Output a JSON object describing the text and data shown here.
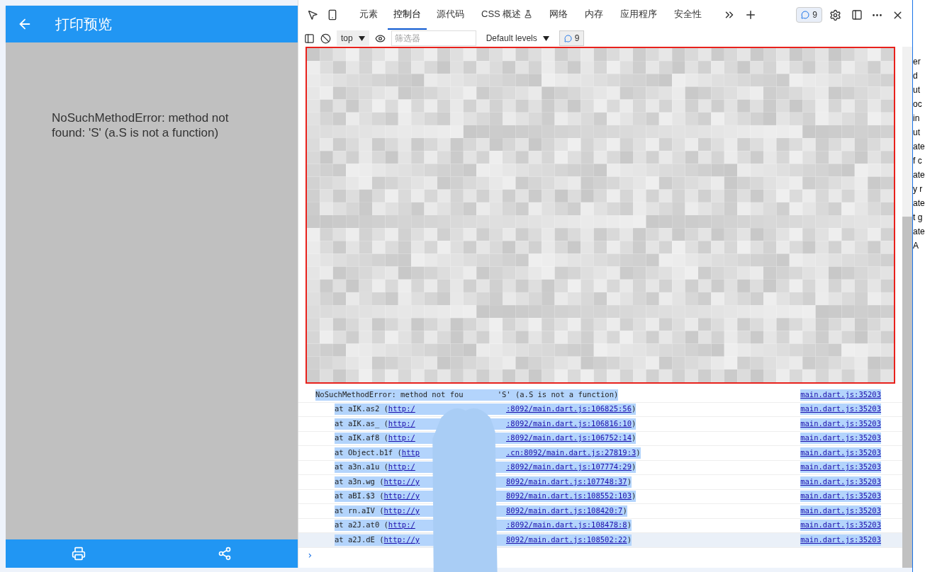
{
  "app": {
    "title": "打印预览",
    "error_message": "NoSuchMethodError: method not found: 'S' (a.S is not a function)"
  },
  "devtools": {
    "tabs": [
      {
        "label": "元素",
        "selected": false
      },
      {
        "label": "控制台",
        "selected": true
      },
      {
        "label": "源代码",
        "selected": false
      },
      {
        "label": "CSS 概述",
        "selected": false
      },
      {
        "label": "网络",
        "selected": false
      },
      {
        "label": "内存",
        "selected": false
      },
      {
        "label": "应用程序",
        "selected": false
      },
      {
        "label": "安全性",
        "selected": false
      }
    ],
    "issues_count": "9",
    "context": "top",
    "filter": {
      "placeholder": "筛选器"
    },
    "levels": "Default levels",
    "message_count": "9",
    "messages": [
      {
        "kind": "error",
        "text": "NoSuchMethodError: method not fou",
        "text_end": "'S' (a.S is not a function)",
        "source": "main.dart.js:35203",
        "hovered": false
      },
      {
        "kind": "frame",
        "text": "at aIK.as2 (",
        "url_start": "http:/",
        "url_end": ":8092/main.dart.js:106825:56",
        "close": ")",
        "source": "main.dart.js:35203",
        "hovered": false
      },
      {
        "kind": "frame",
        "text": "at aIK.as_ (",
        "url_start": "http:/",
        "url_end": ":8092/main.dart.js:106816:10",
        "close": ")",
        "source": "main.dart.js:35203",
        "hovered": false
      },
      {
        "kind": "frame",
        "text": "at aIK.af8 (",
        "url_start": "http:/",
        "url_end": ":8092/main.dart.js:106752:14",
        "close": ")",
        "source": "main.dart.js:35203",
        "hovered": false
      },
      {
        "kind": "frame",
        "text": "at Object.b1f (",
        "url_start": "http",
        "url_end": ".cn:8092/main.dart.js:27819:3",
        "close": ")",
        "source": "main.dart.js:35203",
        "hovered": false
      },
      {
        "kind": "frame",
        "text": "at a3n.a1u (",
        "url_start": "http:/",
        "url_end": ":8092/main.dart.js:107774:29",
        "close": ")",
        "source": "main.dart.js:35203",
        "hovered": false
      },
      {
        "kind": "frame",
        "text": "at a3n.wg (",
        "url_start": "http://y",
        "url_end": "8092/main.dart.js:107748:37",
        "close": ")",
        "source": "main.dart.js:35203",
        "hovered": false
      },
      {
        "kind": "frame",
        "text": "at aBI.$3 (",
        "url_start": "http://y",
        "url_end": "8092/main.dart.js:108552:103",
        "close": ")",
        "source": "main.dart.js:35203",
        "hovered": false
      },
      {
        "kind": "frame",
        "text": "at rn.aIV (",
        "url_start": "http://y",
        "url_end": "8092/main.dart.js:108420:7",
        "close": ")",
        "source": "main.dart.js:35203",
        "hovered": false
      },
      {
        "kind": "frame",
        "text": "at a2J.at0 (",
        "url_start": "http:/",
        "url_end": ":8092/main.dart.js:108478:8",
        "close": ")",
        "source": "main.dart.js:35203",
        "hovered": false
      },
      {
        "kind": "frame",
        "text": "at a2J.dE (",
        "url_start": "http://y",
        "url_end": "8092/main.dart.js:108502:22",
        "close": ")",
        "source": "main.dart.js:35203",
        "hovered": true
      }
    ],
    "prompt": "›"
  },
  "side_page": {
    "fragments": [
      "er",
      "d",
      "ut",
      "oc",
      "in",
      "ut",
      "ate",
      "f c",
      "ate",
      "y r",
      "ate",
      "t g",
      "ate",
      "A"
    ]
  }
}
